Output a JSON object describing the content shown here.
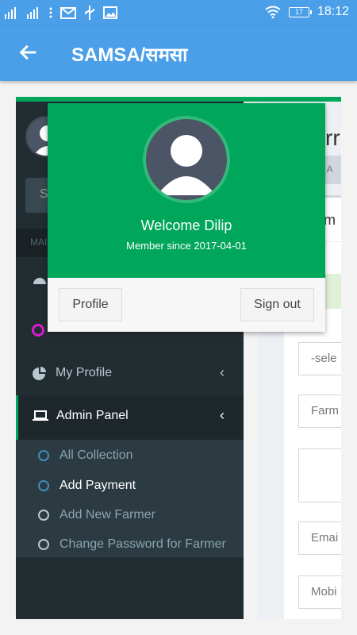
{
  "status_bar": {
    "time": "18:12",
    "battery": "17",
    "icons": [
      "signal-icon",
      "signal-icon",
      "more-icon",
      "gmail-icon",
      "usb-icon",
      "image-icon",
      "wifi-icon",
      "battery-icon"
    ]
  },
  "app_bar": {
    "title": "SAMSA/समसा",
    "back_icon": "arrow-left-icon"
  },
  "sidebar": {
    "search_placeholder": "S",
    "header": "MAI",
    "items": [
      {
        "label": "My Profile",
        "icon": "pie-chart-icon"
      },
      {
        "label": "Admin Panel",
        "icon": "laptop-icon"
      }
    ],
    "sub_items": [
      {
        "label": "All Collection"
      },
      {
        "label": "Add Payment"
      },
      {
        "label": "Add New Farmer"
      },
      {
        "label": "Change Password for Farmer"
      }
    ]
  },
  "content": {
    "title": "rr",
    "breadcrumb": "> A",
    "panel_title": "m",
    "fields": [
      {
        "placeholder": "-sele"
      },
      {
        "placeholder": "Farm"
      },
      {
        "placeholder": ""
      },
      {
        "placeholder": "Emai"
      },
      {
        "placeholder": "Mobi"
      }
    ]
  },
  "user_popup": {
    "welcome": "Welcome Dilip",
    "member_since": "Member since 2017-04-01",
    "profile_button": "Profile",
    "signout_button": "Sign out"
  },
  "colors": {
    "app_bar": "#4a9fe8",
    "accent_green": "#00a65a",
    "sidebar_bg": "#222d32",
    "submenu_bg": "#2c3b41"
  }
}
